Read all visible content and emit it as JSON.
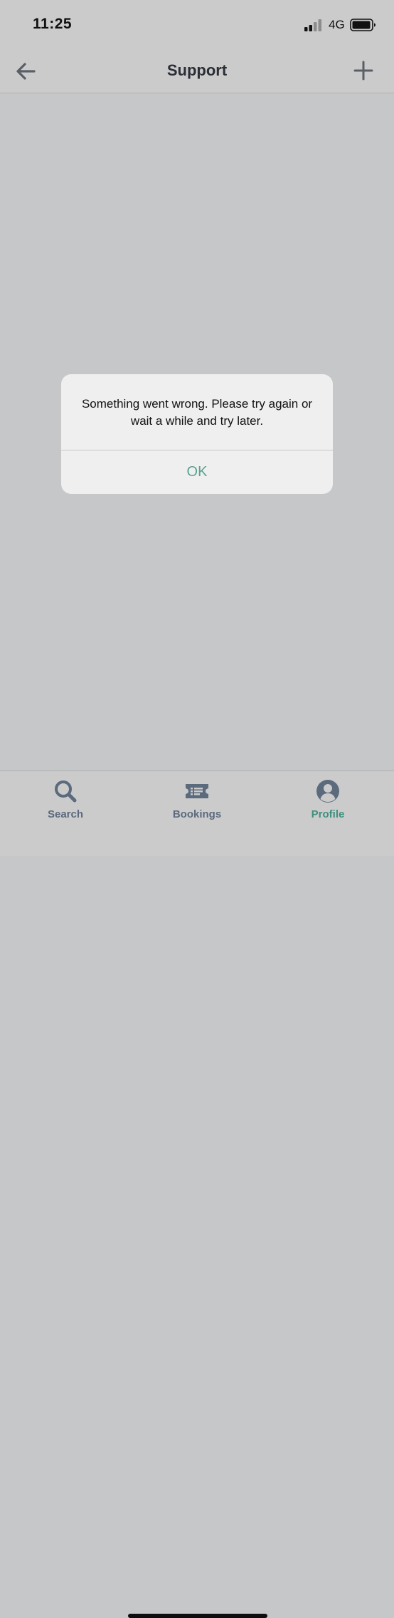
{
  "status_bar": {
    "time": "11:25",
    "network": "4G",
    "signal_icon": "signal-bars-icon",
    "battery_icon": "battery-icon"
  },
  "nav": {
    "title": "Support",
    "back_icon": "arrow-left-icon",
    "add_icon": "plus-icon"
  },
  "alert": {
    "message": "Something went wrong. Please try again or wait a while and try later.",
    "ok_label": "OK"
  },
  "tabs": [
    {
      "label": "Search",
      "icon": "search-icon",
      "active": false
    },
    {
      "label": "Bookings",
      "icon": "ticket-icon",
      "active": false
    },
    {
      "label": "Profile",
      "icon": "profile-icon",
      "active": true
    }
  ],
  "colors": {
    "accent": "#5aa391",
    "inactive_tab": "#5b6a7d",
    "active_tab": "#3f8f7d",
    "overlay": "#c6c7c9"
  }
}
